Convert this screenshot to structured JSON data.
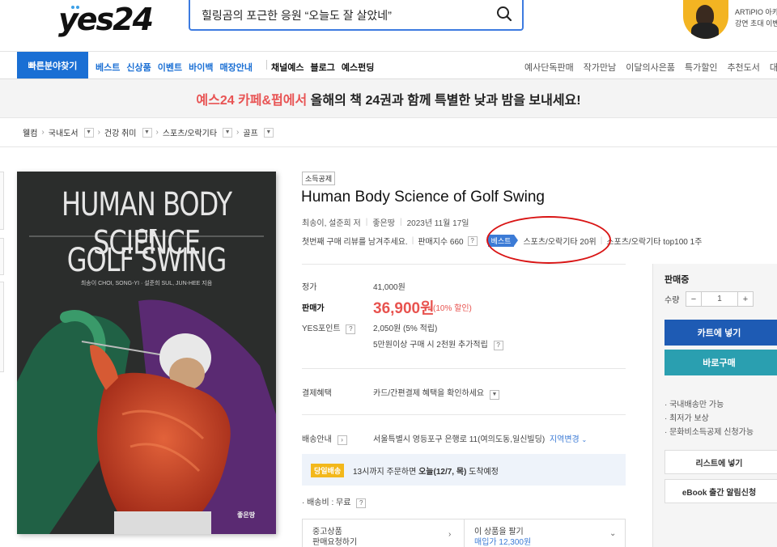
{
  "header": {
    "logo": "yes24",
    "search_value": "힐링곰의 포근한 응원 “오늘도 잘 살았네”",
    "ad_line1": "ARTiPIO 아카",
    "ad_line2": "강연 초대 이벤"
  },
  "nav": {
    "quick": "빠른분야찾기",
    "main": [
      "베스트",
      "신상품",
      "이벤트",
      "바이백",
      "매장안내"
    ],
    "sub": [
      "채널예스",
      "블로그",
      "예스펀딩"
    ],
    "right": [
      "예사단독판매",
      "작가만남",
      "이달의사은품",
      "특가할인",
      "추천도서",
      "대량구"
    ]
  },
  "banner": {
    "highlight": "예스24 카페&펍에서",
    "text": " 올해의 책 24권과 함께 특별한 낮과 밤을 보내세요!"
  },
  "breadcrumb": [
    "웰컴",
    "국내도서",
    "건강 취미",
    "스포츠/오락기타",
    "골프"
  ],
  "cover": {
    "title1": "HUMAN BODY SCIENCE",
    "title2": "OF",
    "title3": "GOLF SWING",
    "authors": "최송이 CHOI, SONG-YI · 설준희 SUL, JUN-HEE 지음",
    "publisher": "좋은땅"
  },
  "product": {
    "tag": "소득공제",
    "title": "Human Body Science of Golf Swing",
    "author": "최송이, 설준희 저",
    "publisher": "좋은땅",
    "date": "2023년 11월 17일",
    "review_prompt": "첫번째 구매 리뷰를 남겨주세요.",
    "sales_index": "판매지수 660",
    "qmark": "?",
    "best_badge": "베스트",
    "rank1": "스포츠/오락기타 20위",
    "rank2": "스포츠/오락기타 top100 1주"
  },
  "price": {
    "list_label": "정가",
    "list_value": "41,000원",
    "sale_label": "판매가",
    "sale_value": "36,900원",
    "discount": "(10% 할인)",
    "points_label": "YES포인트",
    "points_value": "2,050원 (5% 적립)",
    "points_extra": "5만원이상 구매 시 2천원 추가적립"
  },
  "benefits": {
    "label": "결제혜택",
    "value": "카드/간편결제 혜택을 확인하세요"
  },
  "shipping": {
    "label": "배송안내",
    "address": "서울특별시 영등포구 은행로 11(여의도동,일신빌딩)",
    "change": "지역변경",
    "today_badge": "당일배송",
    "today_text_pre": "13시까지 주문하면 ",
    "today_text_bold": "오늘(12/7, 목)",
    "today_text_post": " 도착예정",
    "fee": "· 배송비 : 무료"
  },
  "used": {
    "left1": "중고상품",
    "left2": "판매요청하기",
    "right1": "이 상품을 팔기",
    "right2": "매입가 12,300원"
  },
  "side": {
    "status": "판매중",
    "qty_label": "수량",
    "qty": "1",
    "minus": "−",
    "plus": "+",
    "cart": "카트에 넣기",
    "buy": "바로구매",
    "notes": [
      "· 국내배송만 가능",
      "· 최저가 보상",
      "· 문화비소득공제 신청가능"
    ],
    "wishlist": "리스트에 넣기",
    "ebook": "eBook 출간 알림신청"
  },
  "colors": {
    "accent": "#1a6fd4",
    "price": "#e8534f",
    "cart": "#1e5bb4",
    "buy": "#2a9fb0",
    "annotation": "#d91515"
  }
}
